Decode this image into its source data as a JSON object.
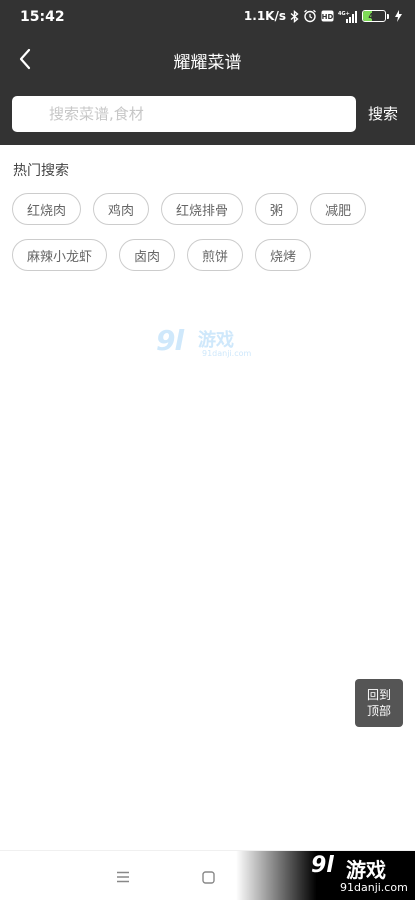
{
  "status_bar": {
    "time": "15:42",
    "net_speed": "1.1K/s",
    "battery_level": "40",
    "battery_fraction": 0.4,
    "icons": [
      "bluetooth-icon",
      "alarm-icon",
      "hd-icon",
      "signal-icon",
      "charging-icon"
    ]
  },
  "header": {
    "title": "耀耀菜谱",
    "back_icon": "back-chevron-icon"
  },
  "search": {
    "placeholder": "搜索菜谱,食材",
    "value": "",
    "button_label": "搜索"
  },
  "hot_search": {
    "title": "热门搜索",
    "tags": [
      "红烧肉",
      "鸡肉",
      "红烧排骨",
      "粥",
      "减肥",
      "麻辣小龙虾",
      "卤肉",
      "煎饼",
      "烧烤"
    ]
  },
  "back_to_top": {
    "line1": "回到",
    "line2": "顶部"
  },
  "watermark": {
    "logo_number": "9l",
    "logo_text": "游戏",
    "domain": "91danji.com"
  },
  "bottom_nav": {
    "icons": [
      "menu-icon",
      "home-icon"
    ]
  },
  "colors": {
    "header_bg": "#333333",
    "tag_border": "#cccccc",
    "back_top_bg": "#555555"
  }
}
